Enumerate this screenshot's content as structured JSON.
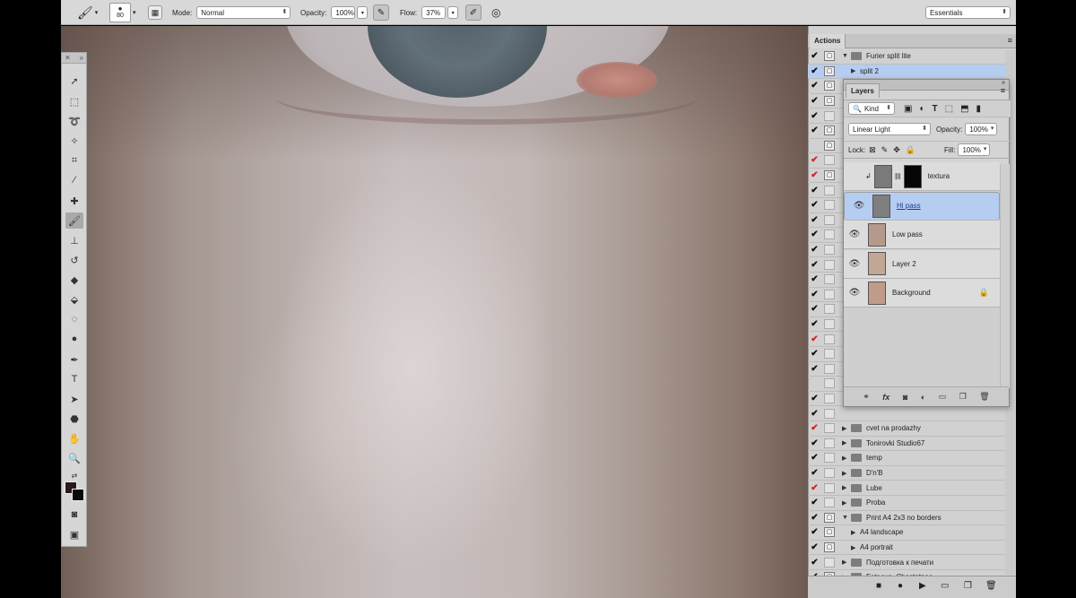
{
  "options_bar": {
    "brush_size": "80",
    "mode_label": "Mode:",
    "mode_value": "Normal",
    "opacity_label": "Opacity:",
    "opacity_value": "100%",
    "flow_label": "Flow:",
    "flow_value": "37%",
    "workspace": "Essentials"
  },
  "actions_panel": {
    "tab": "Actions",
    "rows": [
      {
        "check": "✔",
        "red": false,
        "dialog": "▢",
        "twisty": "▼",
        "folder": true,
        "label": "Furier split lite"
      },
      {
        "check": "✔",
        "red": false,
        "dialog": "▢",
        "twisty": "▶",
        "folder": false,
        "label": "split 2"
      },
      {
        "check": "✔",
        "red": false,
        "dialog": "▢",
        "twisty": "",
        "folder": false,
        "label": ""
      },
      {
        "check": "✔",
        "red": false,
        "dialog": "▢",
        "twisty": "",
        "folder": false,
        "label": ""
      },
      {
        "check": "✔",
        "red": false,
        "dialog": "",
        "twisty": "",
        "folder": false,
        "label": ""
      },
      {
        "check": "✔",
        "red": false,
        "dialog": "▢",
        "twisty": "",
        "folder": false,
        "label": ""
      },
      {
        "check": "",
        "red": false,
        "dialog": "▢",
        "twisty": "",
        "folder": false,
        "label": ""
      },
      {
        "check": "✔",
        "red": true,
        "dialog": "",
        "twisty": "",
        "folder": false,
        "label": ""
      },
      {
        "check": "✔",
        "red": true,
        "dialog": "▢",
        "twisty": "",
        "folder": false,
        "label": ""
      },
      {
        "check": "✔",
        "red": false,
        "dialog": "",
        "twisty": "",
        "folder": false,
        "label": ""
      },
      {
        "check": "✔",
        "red": false,
        "dialog": "",
        "twisty": "",
        "folder": false,
        "label": ""
      },
      {
        "check": "✔",
        "red": false,
        "dialog": "",
        "twisty": "",
        "folder": false,
        "label": ""
      },
      {
        "check": "✔",
        "red": false,
        "dialog": "",
        "twisty": "",
        "folder": false,
        "label": ""
      },
      {
        "check": "✔",
        "red": false,
        "dialog": "",
        "twisty": "",
        "folder": false,
        "label": ""
      },
      {
        "check": "✔",
        "red": false,
        "dialog": "",
        "twisty": "",
        "folder": false,
        "label": ""
      },
      {
        "check": "✔",
        "red": false,
        "dialog": "",
        "twisty": "",
        "folder": false,
        "label": ""
      },
      {
        "check": "✔",
        "red": false,
        "dialog": "",
        "twisty": "",
        "folder": false,
        "label": ""
      },
      {
        "check": "✔",
        "red": false,
        "dialog": "",
        "twisty": "",
        "folder": false,
        "label": ""
      },
      {
        "check": "✔",
        "red": false,
        "dialog": "",
        "twisty": "",
        "folder": false,
        "label": ""
      },
      {
        "check": "✔",
        "red": true,
        "dialog": "",
        "twisty": "",
        "folder": false,
        "label": ""
      },
      {
        "check": "✔",
        "red": false,
        "dialog": "",
        "twisty": "",
        "folder": false,
        "label": ""
      },
      {
        "check": "✔",
        "red": false,
        "dialog": "",
        "twisty": "",
        "folder": false,
        "label": ""
      },
      {
        "check": "",
        "red": false,
        "dialog": "",
        "twisty": "",
        "folder": false,
        "label": ""
      },
      {
        "check": "✔",
        "red": false,
        "dialog": "",
        "twisty": "",
        "folder": false,
        "label": ""
      },
      {
        "check": "✔",
        "red": false,
        "dialog": "",
        "twisty": "",
        "folder": false,
        "label": ""
      },
      {
        "check": "✔",
        "red": true,
        "dialog": "",
        "twisty": "▶",
        "folder": true,
        "label": "cvet na prodazhy"
      },
      {
        "check": "✔",
        "red": false,
        "dialog": "",
        "twisty": "▶",
        "folder": true,
        "label": "Tonirovki Studio67"
      },
      {
        "check": "✔",
        "red": false,
        "dialog": "",
        "twisty": "▶",
        "folder": true,
        "label": "temp"
      },
      {
        "check": "✔",
        "red": false,
        "dialog": "",
        "twisty": "▶",
        "folder": true,
        "label": "D'n'B"
      },
      {
        "check": "✔",
        "red": true,
        "dialog": "",
        "twisty": "▶",
        "folder": true,
        "label": "Lube"
      },
      {
        "check": "✔",
        "red": false,
        "dialog": "",
        "twisty": "▶",
        "folder": true,
        "label": "Proba"
      },
      {
        "check": "✔",
        "red": false,
        "dialog": "▢",
        "twisty": "▼",
        "folder": true,
        "label": "Print A4 2x3 no borders"
      },
      {
        "check": "✔",
        "red": false,
        "dialog": "▢",
        "twisty": "▶",
        "folder": false,
        "label": "A4 landscape"
      },
      {
        "check": "✔",
        "red": false,
        "dialog": "▢",
        "twisty": "▶",
        "folder": false,
        "label": "A4 portrait"
      },
      {
        "check": "✔",
        "red": false,
        "dialog": "",
        "twisty": "▶",
        "folder": true,
        "label": "Подготовка к печати"
      },
      {
        "check": "✔",
        "red": false,
        "dialog": "▢",
        "twisty": "▶",
        "folder": true,
        "label": "Fateeva_Chastotnoe"
      }
    ]
  },
  "layers_panel": {
    "tab": "Layers",
    "filter_kind": "Kind",
    "blend_mode": "Linear Light",
    "opacity_label": "Opacity:",
    "opacity_value": "100%",
    "lock_label": "Lock:",
    "fill_label": "Fill:",
    "fill_value": "100%",
    "layers": [
      {
        "name": "textura",
        "visible": false,
        "selected": false,
        "locked": false,
        "thumb": "#7a7a7a",
        "mask": true
      },
      {
        "name": "Hi pass",
        "visible": true,
        "selected": true,
        "locked": false,
        "thumb": "#7f7f7f",
        "mask": false
      },
      {
        "name": "Low pass",
        "visible": true,
        "selected": false,
        "locked": false,
        "thumb": "#b59a8c",
        "mask": false
      },
      {
        "name": "Layer 2",
        "visible": true,
        "selected": false,
        "locked": false,
        "thumb": "#c4a694",
        "mask": false
      },
      {
        "name": "Background",
        "visible": true,
        "selected": false,
        "locked": true,
        "thumb": "#c09b88",
        "mask": false
      }
    ]
  },
  "colors": {
    "selection": "#b6cdf2",
    "panel_bg": "#d1d1d1",
    "check_red": "#d02020"
  }
}
